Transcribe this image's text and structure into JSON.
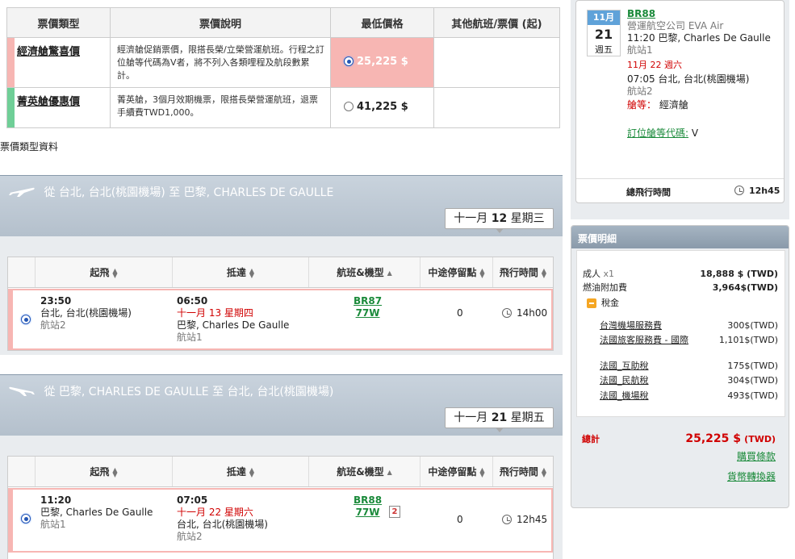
{
  "fare_table": {
    "headers": [
      "票價類型",
      "票價說明",
      "最低價格",
      "其他航班/票價 (起)"
    ],
    "rows": [
      {
        "name": "經濟艙驚喜價",
        "desc": "經濟艙促銷票價，限搭長榮/立榮營運航班。行程之訂位艙等代碼為V者，將不列入各類哩程及航段數累計。",
        "price": "25,225 $",
        "color": "#f7b6b3"
      },
      {
        "name": "菁英艙優惠價",
        "desc": "菁英艙，3個月效期機票，限搭長榮營運航班，退票手續費TWD1,000。",
        "price": "41,225 $",
        "color": "#6fcf97"
      }
    ],
    "footnote": "票價類型資料"
  },
  "outbound": {
    "prefix": "從",
    "from": "台北, 台北(桃園機場)",
    "mid": "至",
    "to": "巴黎, CHARLES DE GAULLE",
    "date_a": "十一月",
    "date_b": "12",
    "date_c": "星期三",
    "headers": [
      "起飛",
      "抵達",
      "航班&機型",
      "中途停留點",
      "飛行時間"
    ],
    "dep_time": "23:50",
    "dep_city": "台北, 台北(桃園機場)",
    "dep_term": "航站2",
    "arr_time": "06:50",
    "arr_date": "十一月 13 星期四",
    "arr_city": "巴黎, Charles De Gaulle",
    "arr_term": "航站1",
    "flight": "BR87",
    "aircraft": "77W",
    "stops": "0",
    "duration": "14h00"
  },
  "inbound": {
    "prefix": "從",
    "from": "巴黎, CHARLES DE GAULLE",
    "mid": "至",
    "to": "台北, 台北(桃園機場)",
    "date_a": "十一月",
    "date_b": "21",
    "date_c": "星期五",
    "headers": [
      "起飛",
      "抵達",
      "航班&機型",
      "中途停留點",
      "飛行時間"
    ],
    "dep_time": "11:20",
    "dep_city": "巴黎, Charles De Gaulle",
    "dep_term": "航站1",
    "arr_time": "07:05",
    "arr_date": "十一月 22 星期六",
    "arr_city": "台北, 台北(桃園機場)",
    "arr_term": "航站2",
    "flight": "BR88",
    "aircraft": "77W",
    "badge": "2",
    "stops": "0",
    "duration": "12h45"
  },
  "flight_detail": {
    "cal_month": "11月",
    "cal_day": "21",
    "cal_weekday": "週五",
    "flight": "BR88",
    "operator_label": "營運航空公司",
    "operator": "EVA Air",
    "dep": "11:20 巴黎, Charles De Gaulle",
    "dep_term": "航站1",
    "arr_date": "11月 22 週六",
    "arr": "07:05 台北, 台北(桃園機場)",
    "arr_term": "航站2",
    "cabin_label": "艙等：",
    "cabin": "經濟艙",
    "class_label": "訂位艙等代碼:",
    "class": "V",
    "total_label": "總飛行時間",
    "total": "12h45"
  },
  "price_detail": {
    "title": "票價明細",
    "adult_label": "成人",
    "adult_count": "x1",
    "adult_price": "18,888 $ (TWD)",
    "fuel_label": "燃油附加費",
    "fuel_price": "3,964$(TWD)",
    "tax_label": "稅金",
    "taxes": [
      {
        "name": "台灣機場服務費",
        "amount": "300$(TWD)"
      },
      {
        "name": "法國旅客服務費 - 國際",
        "amount": "1,101$(TWD)"
      },
      {
        "name": "法國_互助稅",
        "amount": "175$(TWD)"
      },
      {
        "name": "法國_民航稅",
        "amount": "304$(TWD)"
      },
      {
        "name": "法國_機場稅",
        "amount": "493$(TWD)"
      }
    ],
    "total_label": "總計",
    "total": "25,225 $",
    "total_unit": "(TWD)",
    "buy_terms": "購買條款",
    "converter": "貨幣轉換器"
  }
}
